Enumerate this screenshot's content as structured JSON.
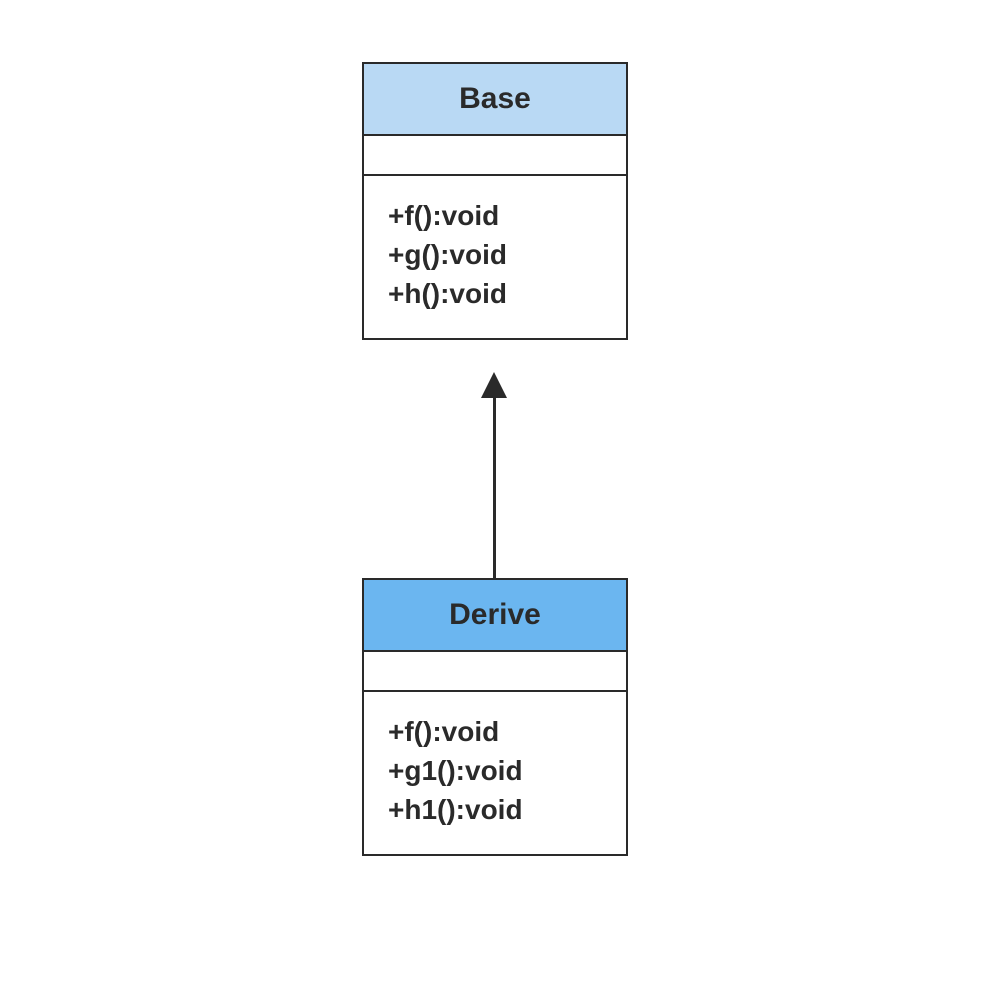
{
  "classes": {
    "base": {
      "name": "Base",
      "methods": [
        "+f():void",
        "+g():void",
        "+h():void"
      ]
    },
    "derive": {
      "name": "Derive",
      "methods": [
        "+f():void",
        "+g1():void",
        "+h1():void"
      ]
    }
  }
}
